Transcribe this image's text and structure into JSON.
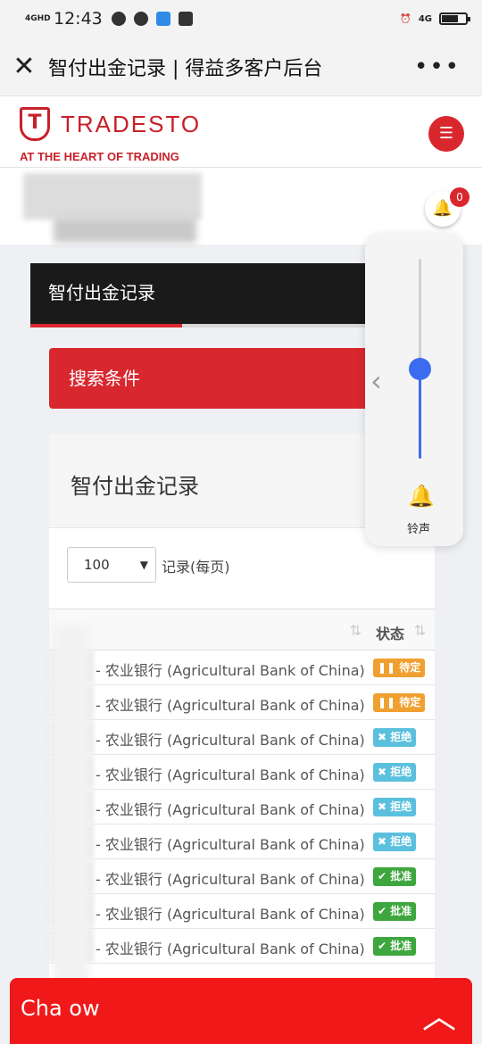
{
  "status_bar": {
    "network": "4GHD",
    "time": "12:43",
    "right_network": "4G"
  },
  "title_bar": {
    "title": "智付出金记录 | 得益多客户后台"
  },
  "site": {
    "logo_letter": "T",
    "logo_text": "TRADESTO",
    "tagline": "AT THE HEART OF TRADING",
    "notification_count": "0"
  },
  "section": {
    "title": "智付出金记录",
    "search_label": "搜索条件"
  },
  "panel": {
    "title": "智付出金记录",
    "per_page_value": "100",
    "per_page_label": "记录(每页)",
    "status_header": "状态"
  },
  "rows": [
    {
      "bank": "- 农业银行 (Agricultural Bank of China)",
      "status": "待定",
      "type": "pending"
    },
    {
      "bank": "- 农业银行 (Agricultural Bank of China)",
      "status": "待定",
      "type": "pending"
    },
    {
      "bank": "- 农业银行 (Agricultural Bank of China)",
      "status": "拒绝",
      "type": "rejected"
    },
    {
      "bank": "- 农业银行 (Agricultural Bank of China)",
      "status": "拒绝",
      "type": "rejected"
    },
    {
      "bank": "- 农业银行 (Agricultural Bank of China)",
      "status": "拒绝",
      "type": "rejected"
    },
    {
      "bank": "- 农业银行 (Agricultural Bank of China)",
      "status": "拒绝",
      "type": "rejected"
    },
    {
      "bank": "- 农业银行 (Agricultural Bank of China)",
      "status": "批准",
      "type": "approved"
    },
    {
      "bank": "- 农业银行 (Agricultural Bank of China)",
      "status": "批准",
      "type": "approved"
    },
    {
      "bank": "- 农业银行 (Agricultural Bank of China)",
      "status": "批准",
      "type": "approved"
    }
  ],
  "volume": {
    "label": "铃声",
    "level": 0.45
  },
  "chat": {
    "label": "Cha      ow"
  },
  "colors": {
    "brand_red": "#c8202a",
    "pending": "#f0a030",
    "rejected": "#5bc0de",
    "approved": "#3ea63e"
  }
}
